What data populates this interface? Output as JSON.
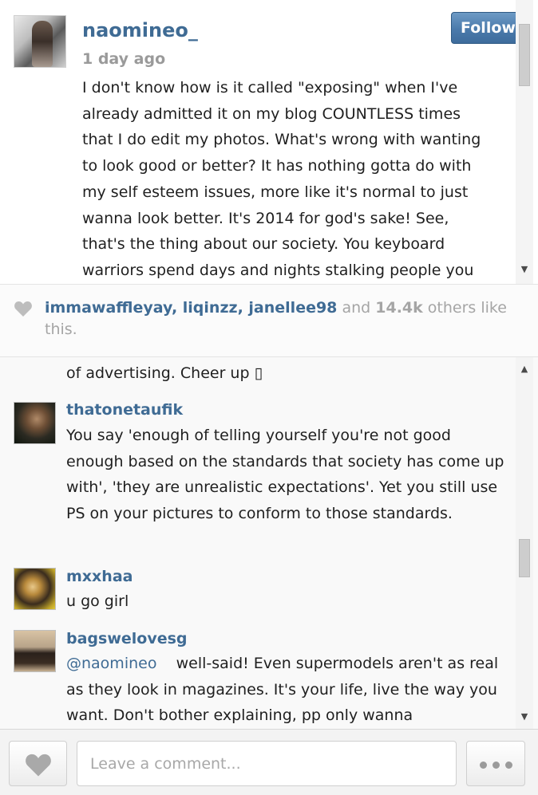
{
  "post": {
    "username": "naomineo_",
    "time_ago": "1 day ago",
    "follow_label": "Follow",
    "caption": "I don't know how is it called \"exposing\" when I've\nalready admitted it on my blog COUNTLESS times\nthat I do edit my photos. What's wrong with wanting\nto look good or better? It has nothing gotta do with\nmy self esteem issues, more like it's normal to just\nwanna look better. It's 2014 for god's sake! See,\nthat's the thing about our society. You keyboard\nwarriors spend days and nights stalking people you"
  },
  "likes": {
    "user1": "immawaffleyay",
    "sep1": ", ",
    "user2": "liqinzz",
    "sep2": ", ",
    "user3": "janellee98",
    "and_text": " and ",
    "count": "14.4k",
    "suffix": " others like this."
  },
  "comments": {
    "partial_text": "of advertising. Cheer up ▯",
    "items": [
      {
        "user": "thatonetaufik",
        "text": "You say 'enough of telling yourself you're not good enough based on the standards that society has come up with', 'they are unrealistic expectations'. Yet you still use PS on your pictures to conform to those standards."
      },
      {
        "user": "mxxhaa",
        "text": "u go girl"
      },
      {
        "user": "bagswelovesg",
        "mention": "@naomineo",
        "text": "    well-said! Even supermodels aren't as real as they look in magazines. It's your life, live the way you want. Don't bother explaining, pp only wanna"
      }
    ]
  },
  "comment_box": {
    "placeholder": "Leave a comment..."
  },
  "icons": {
    "like": "heart-icon",
    "more": "ellipsis-icon",
    "scroll_up": "triangle-up-icon",
    "scroll_down": "triangle-down-icon"
  }
}
